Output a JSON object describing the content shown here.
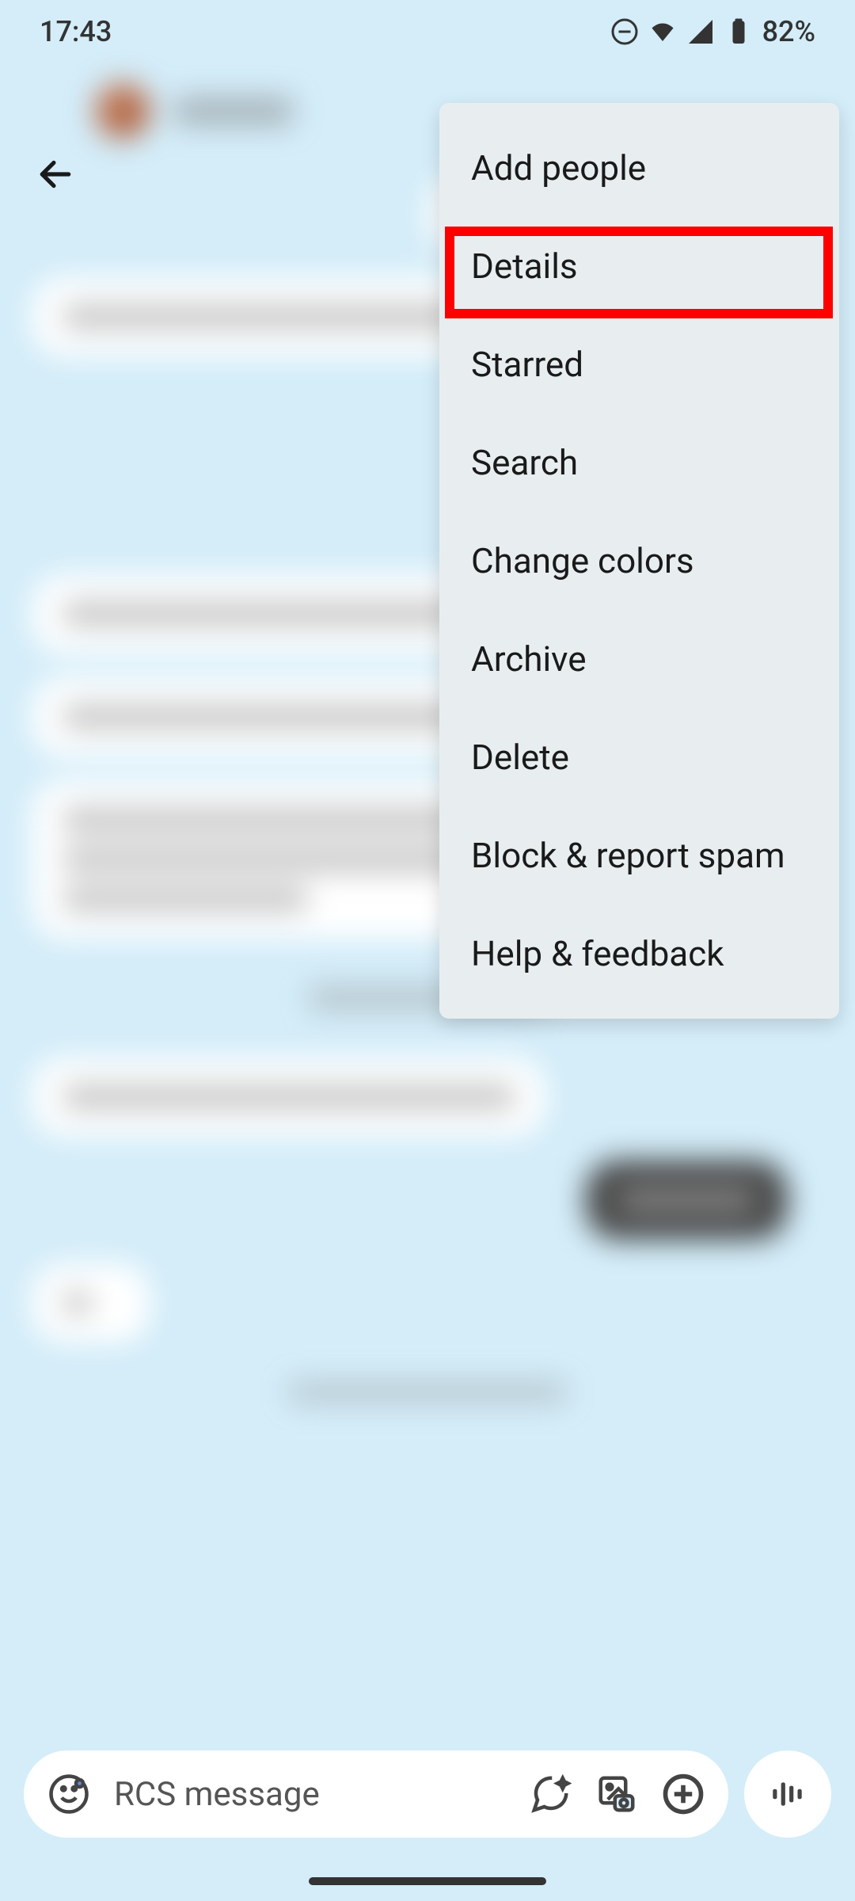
{
  "status_bar": {
    "time": "17:43",
    "battery_percent": "82%"
  },
  "input": {
    "placeholder": "RCS message"
  },
  "menu": {
    "items": [
      "Add people",
      "Details",
      "Starred",
      "Search",
      "Change colors",
      "Archive",
      "Delete",
      "Block & report spam",
      "Help & feedback"
    ]
  }
}
